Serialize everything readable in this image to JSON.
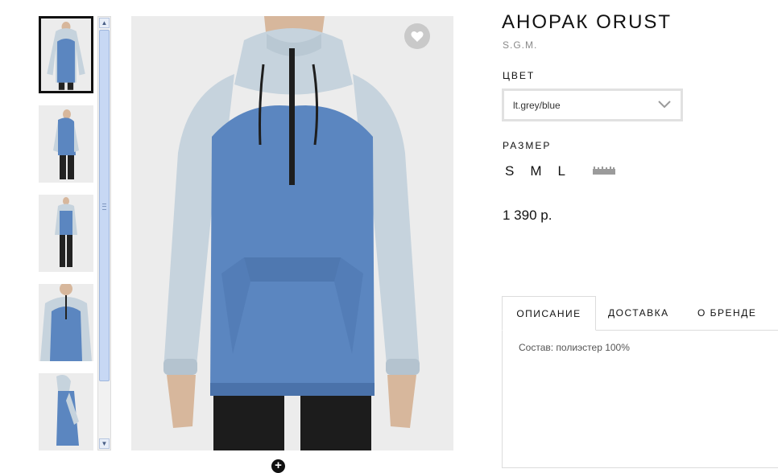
{
  "product": {
    "title": "АНОРАК ORUST",
    "brand": "S.G.M.",
    "price": "1 390 р."
  },
  "color": {
    "label": "ЦВЕТ",
    "selected": "lt.grey/blue"
  },
  "size": {
    "label": "РАЗМЕР",
    "options": [
      "S",
      "M",
      "L"
    ]
  },
  "tabs": [
    {
      "label": "ОПИСАНИЕ"
    },
    {
      "label": "ДОСТАВКА"
    },
    {
      "label": "О БРЕНДЕ"
    }
  ],
  "description": "Состав: полиэстер 100%",
  "icons": {
    "favorite": "heart-icon",
    "zoom": "plus-circle-icon",
    "size_chart": "ruler-icon",
    "dropdown": "chevron-down-icon"
  },
  "colors": {
    "jacket_blue": "#5b86c0",
    "jacket_grey": "#c6d3dd",
    "selected_thumb_border": "#111111",
    "photo_background": "#ececec"
  },
  "thumbnails": {
    "count": 5,
    "selected_index": 0
  }
}
